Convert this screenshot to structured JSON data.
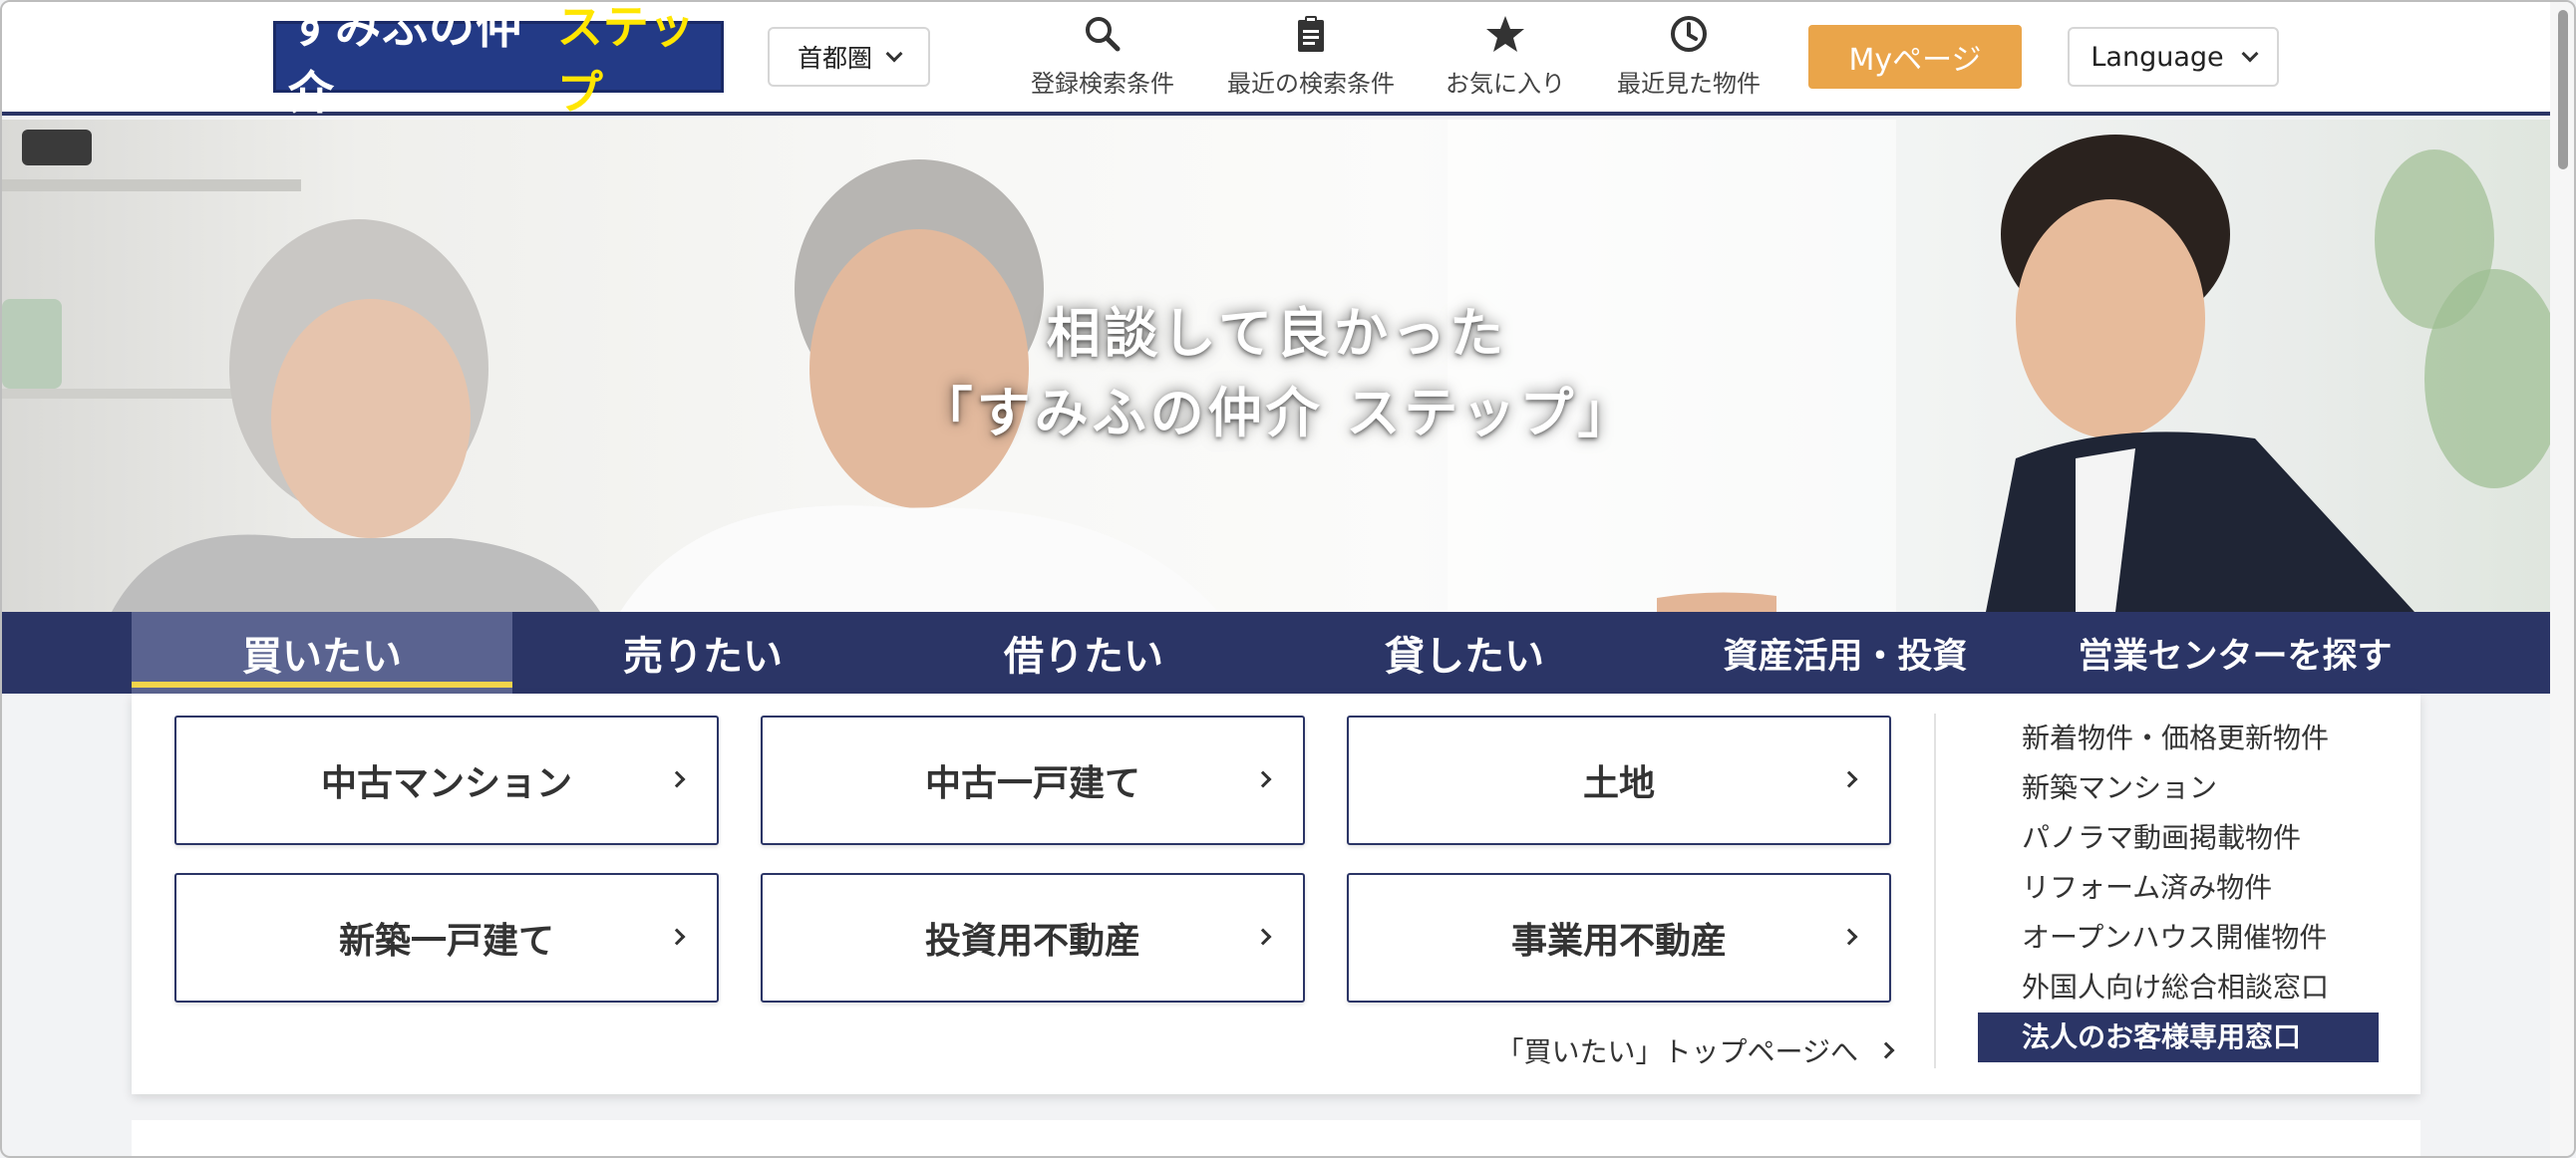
{
  "header": {
    "logo_left": "すみふの仲介",
    "logo_right": "ステップ",
    "region": "首都圏",
    "nav": [
      {
        "label": "登録検索条件",
        "icon": "search-icon"
      },
      {
        "label": "最近の検索条件",
        "icon": "clipboard-icon"
      },
      {
        "label": "お気に入り",
        "icon": "star-icon"
      },
      {
        "label": "最近見た物件",
        "icon": "clock-icon"
      }
    ],
    "mypage": "Myページ",
    "language": "Language"
  },
  "hero": {
    "line1": "相談して良かった",
    "line2": "「すみふの仲介 ステップ」"
  },
  "tabs": [
    {
      "label": "買いたい",
      "active": true
    },
    {
      "label": "売りたい"
    },
    {
      "label": "借りたい"
    },
    {
      "label": "貸したい"
    },
    {
      "label": "資産活用・投資"
    },
    {
      "label": "営業センターを探す"
    }
  ],
  "panel": {
    "categories": [
      "中古マンション",
      "中古一戸建て",
      "土地",
      "新築一戸建て",
      "投資用不動産",
      "事業用不動産"
    ],
    "top_link": "「買いたい」トップページへ",
    "side_links": [
      "新着物件・価格更新物件",
      "新築マンション",
      "パノラマ動画掲載物件",
      "リフォーム済み物件",
      "オープンハウス開催物件",
      "外国人向け総合相談窓口",
      "法人のお客様専用窓口"
    ]
  },
  "colors": {
    "navy": "#2b3566",
    "accent_orange": "#eaa54a",
    "active_underline": "#f3d54a",
    "logo_bg": "#233a86",
    "logo_yellow": "#ffe600"
  }
}
